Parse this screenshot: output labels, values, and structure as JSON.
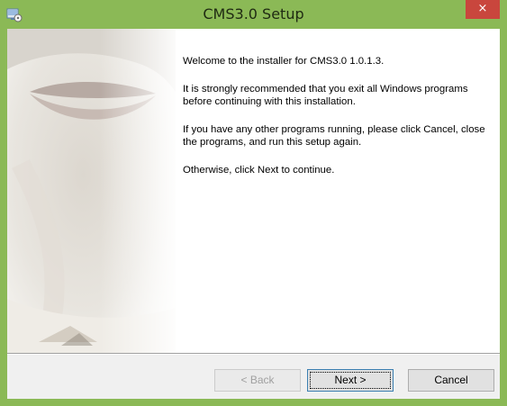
{
  "window": {
    "title": "CMS3.0 Setup",
    "icon": "installer-icon",
    "close_glyph": "×",
    "accent": "#8bb956"
  },
  "welcome": {
    "line1": "Welcome to the installer for CMS3.0 1.0.1.3.",
    "line2": "It is strongly recommended that you exit all Windows programs before continuing with this installation.",
    "line3": "If you have any other programs running, please click Cancel, close the programs, and run this setup again.",
    "line4": "Otherwise, click Next to continue."
  },
  "buttons": {
    "back_label": "< Back",
    "next_label": "Next >",
    "cancel_label": "Cancel",
    "back_enabled": false
  }
}
